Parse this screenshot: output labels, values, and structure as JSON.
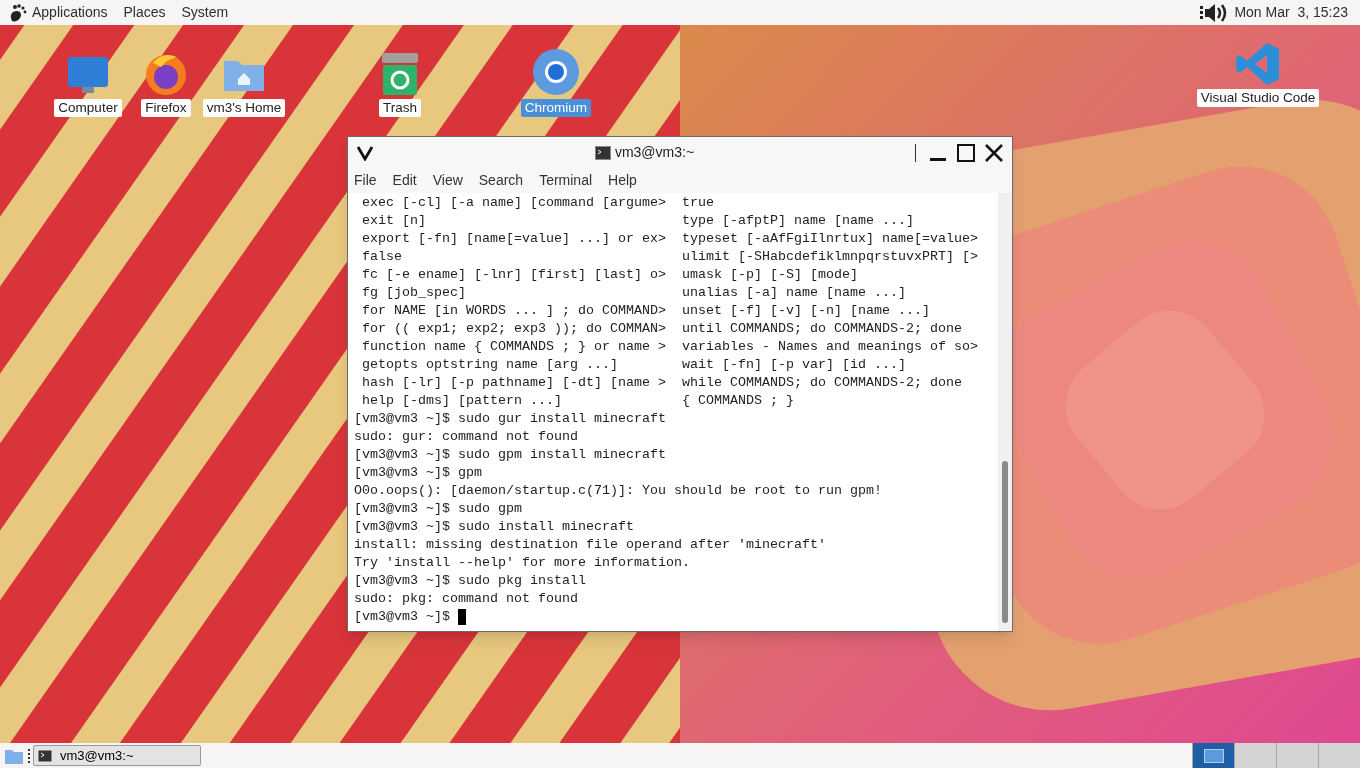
{
  "top_panel": {
    "menus": [
      "Applications",
      "Places",
      "System"
    ],
    "clock": "Mon Mar  3, 15:23"
  },
  "desktop_icons": [
    {
      "kind": "computer",
      "label": "Computer",
      "selected": false
    },
    {
      "kind": "firefox",
      "label": "Firefox",
      "selected": false
    },
    {
      "kind": "home",
      "label": "vm3's Home",
      "selected": false
    },
    {
      "kind": "trash",
      "label": "Trash",
      "selected": false
    },
    {
      "kind": "chromium",
      "label": "Chromium",
      "selected": true
    },
    {
      "kind": "vscode",
      "label": "Visual Studio Code",
      "selected": false
    }
  ],
  "terminal": {
    "title": "vm3@vm3:~",
    "menus": [
      "File",
      "Edit",
      "View",
      "Search",
      "Terminal",
      "Help"
    ],
    "help_rows": [
      {
        "left": "exec [-cl] [-a name] [command [argume>",
        "right": "true"
      },
      {
        "left": "exit [n]",
        "right": "type [-afptP] name [name ...]"
      },
      {
        "left": "export [-fn] [name[=value] ...] or ex>",
        "right": "typeset [-aAfFgiIlnrtux] name[=value>"
      },
      {
        "left": "false",
        "right": "ulimit [-SHabcdefiklmnpqrstuvxPRT] [>"
      },
      {
        "left": "fc [-e ename] [-lnr] [first] [last] o>",
        "right": "umask [-p] [-S] [mode]"
      },
      {
        "left": "fg [job_spec]",
        "right": "unalias [-a] name [name ...]"
      },
      {
        "left": "for NAME [in WORDS ... ] ; do COMMAND>",
        "right": "unset [-f] [-v] [-n] [name ...]"
      },
      {
        "left": "for (( exp1; exp2; exp3 )); do COMMAN>",
        "right": "until COMMANDS; do COMMANDS-2; done"
      },
      {
        "left": "function name { COMMANDS ; } or name >",
        "right": "variables - Names and meanings of so>"
      },
      {
        "left": "getopts optstring name [arg ...]",
        "right": "wait [-fn] [-p var] [id ...]"
      },
      {
        "left": "hash [-lr] [-p pathname] [-dt] [name >",
        "right": "while COMMANDS; do COMMANDS-2; done"
      },
      {
        "left": "help [-dms] [pattern ...]",
        "right": "{ COMMANDS ; }"
      }
    ],
    "lines": [
      "[vm3@vm3 ~]$ sudo gur install minecraft",
      "sudo: gur: command not found",
      "[vm3@vm3 ~]$ sudo gpm install minecraft",
      "[vm3@vm3 ~]$ gpm",
      "O0o.oops(): [daemon/startup.c(71)]: You should be root to run gpm!",
      "[vm3@vm3 ~]$ sudo gpm",
      "[vm3@vm3 ~]$ sudo install minecraft",
      "install: missing destination file operand after 'minecraft'",
      "Try 'install --help' for more information.",
      "[vm3@vm3 ~]$ sudo pkg install",
      "sudo: pkg: command not found"
    ],
    "prompt": "[vm3@vm3 ~]$ "
  },
  "taskbar": {
    "tasks": [
      {
        "title": "vm3@vm3:~"
      }
    ],
    "workspaces": [
      {
        "selected": true
      },
      {
        "selected": false
      },
      {
        "selected": false
      },
      {
        "selected": false
      }
    ]
  }
}
